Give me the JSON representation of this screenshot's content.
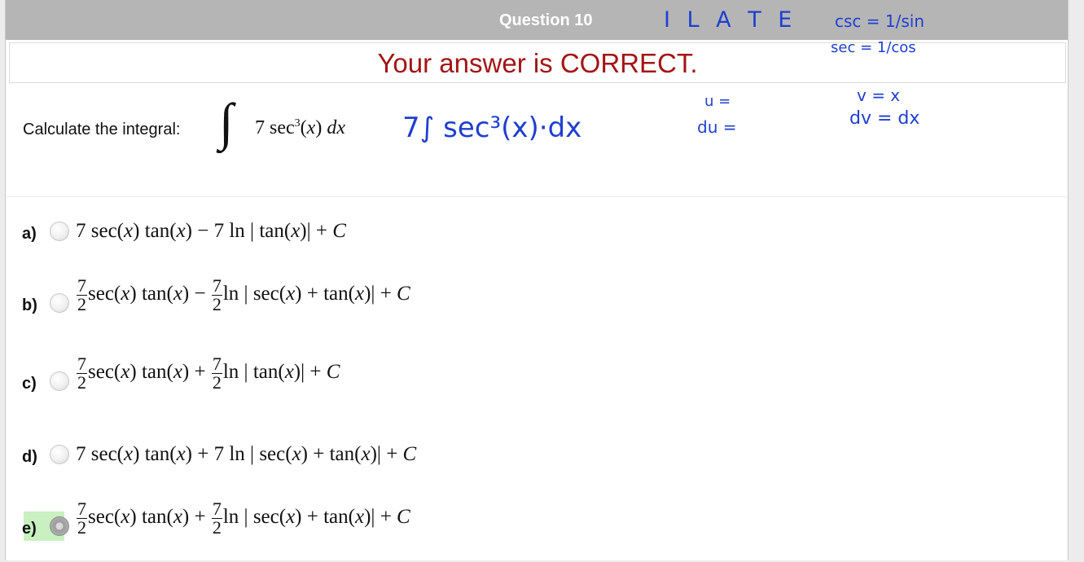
{
  "header": {
    "title": "Question 10"
  },
  "banner": {
    "message": "Your answer is CORRECT."
  },
  "question": {
    "prompt": "Calculate the integral:",
    "integral_sign": "∫",
    "integrand_text": "7 sec³(x) dx"
  },
  "options": [
    {
      "label": "a)",
      "selected": false,
      "expression": "7 sec(x) tan(x) − 7 ln | tan(x)| + C"
    },
    {
      "label": "b)",
      "selected": false,
      "expression": "(7/2) sec(x) tan(x) − (7/2) ln | sec(x) + tan(x)| + C"
    },
    {
      "label": "c)",
      "selected": false,
      "expression": "(7/2) sec(x) tan(x) + (7/2) ln | tan(x)| + C"
    },
    {
      "label": "d)",
      "selected": false,
      "expression": "7 sec(x) tan(x) + 7 ln | sec(x) + tan(x)| + C"
    },
    {
      "label": "e)",
      "selected": true,
      "expression": "(7/2) sec(x) tan(x) + (7/2) ln | sec(x) + tan(x)| + C"
    }
  ],
  "math_parts": {
    "seven": "7",
    "two": "2",
    "x": "x",
    "C": "C",
    "sec": "sec(",
    "tan": "tan(",
    "close": ")",
    "minus": "−",
    "plus": "+",
    "ln": "ln |",
    "abs_close": "|",
    "sec_cube_exp": "3",
    "dx": "dx"
  },
  "handwritten_notes": {
    "ilate": "I L A T E",
    "csc_rule": "csc = 1/sin",
    "sec_rule": "sec = 1/cos",
    "u_line": "u =",
    "du_line": "du =",
    "v_line": "v = x",
    "dv_line": "dv = dx",
    "rewrite": "7∫ sec³(x)·dx"
  },
  "colors": {
    "banner_text": "#a31515",
    "header_bg": "#b5b5b5",
    "ink": "#1f3fd0",
    "selected_highlight": "#c8f0c0"
  }
}
